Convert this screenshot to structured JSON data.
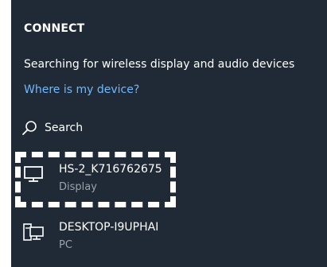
{
  "panel": {
    "title": "CONNECT",
    "status_text": "Searching for wireless display and audio devices",
    "help_link": "Where is my device?",
    "search_label": "Search"
  },
  "devices": [
    {
      "name": "HS-2_K716762675",
      "type": "Display",
      "icon": "monitor-icon"
    },
    {
      "name": "DESKTOP-I9UPHAI",
      "type": "PC",
      "icon": "pc-icon"
    }
  ],
  "colors": {
    "panel_bg": "#1f2a36",
    "link": "#6fb8ff",
    "secondary_text": "#9aa3ad",
    "highlight": "#ffffff"
  }
}
